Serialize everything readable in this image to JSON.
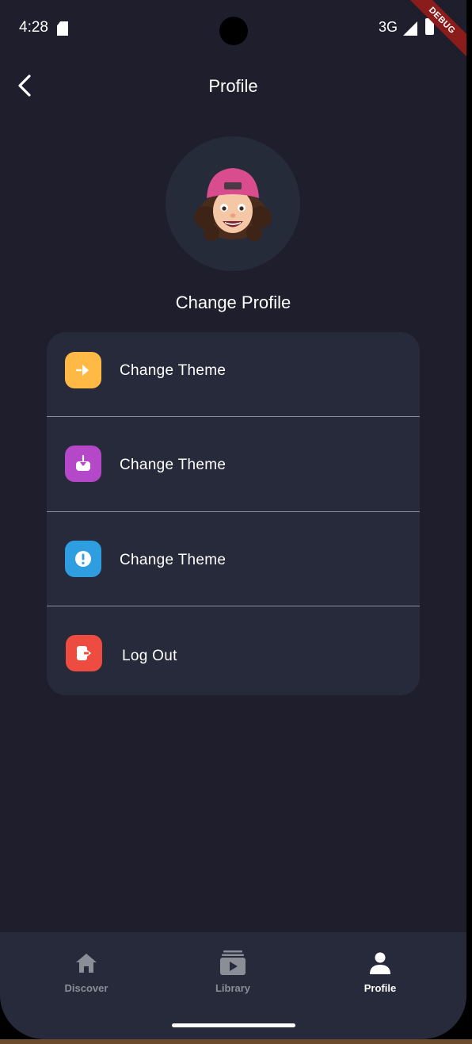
{
  "status_bar": {
    "time": "4:28",
    "network": "3G",
    "icons": [
      "sd-card-icon",
      "signal-icon",
      "battery-icon"
    ]
  },
  "debug_banner": "DEBUG",
  "appbar": {
    "title": "Profile",
    "back_icon": "chevron-left-icon"
  },
  "profile": {
    "avatar": "memoji-avatar",
    "change_label": "Change Profile"
  },
  "menu": {
    "items": [
      {
        "label": "Change Theme",
        "icon": "arrow-right-circle-icon",
        "color": "#ffb944"
      },
      {
        "label": "Change Theme",
        "icon": "download-tray-icon",
        "color": "#b547c9"
      },
      {
        "label": "Change Theme",
        "icon": "info-circle-icon",
        "color": "#2f9ee0"
      },
      {
        "label": "Log Out",
        "icon": "logout-icon",
        "color": "#ee4c41"
      }
    ]
  },
  "bottom_nav": {
    "items": [
      {
        "label": "Discover",
        "icon": "home-icon",
        "active": false
      },
      {
        "label": "Library",
        "icon": "library-icon",
        "active": false
      },
      {
        "label": "Profile",
        "icon": "person-icon",
        "active": true
      }
    ]
  },
  "colors": {
    "background": "#1f1e2d",
    "card": "#262a3a",
    "inactive": "#8b8e97",
    "active": "#ffffff"
  }
}
